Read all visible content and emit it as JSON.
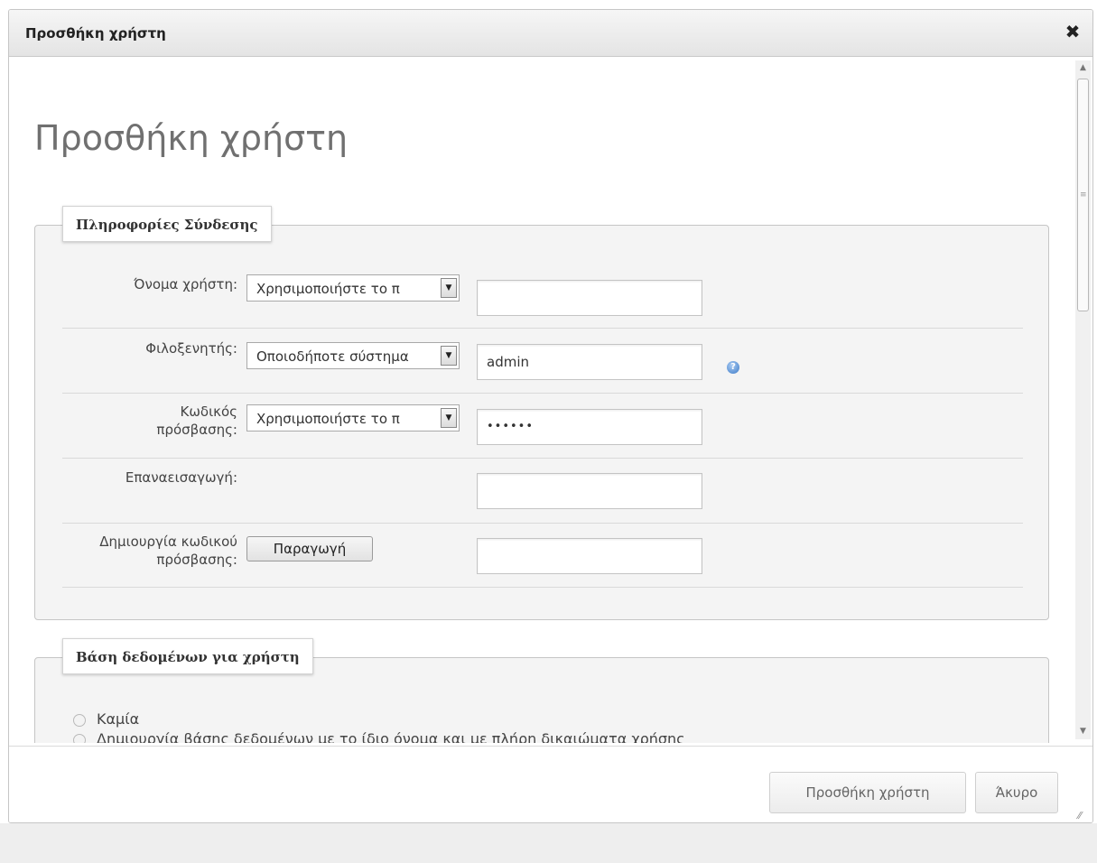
{
  "dialog": {
    "title": "Προσθήκη χρήστη",
    "close_icon": "close-icon"
  },
  "page": {
    "heading": "Προσθήκη χρήστη"
  },
  "login_section": {
    "legend": "Πληροφορίες Σύνδεσης",
    "username": {
      "label": "Όνομα χρήστη:",
      "select_value": "Χρησιμοποιήστε το π",
      "input_value": ""
    },
    "host": {
      "label": "Φιλοξενητής:",
      "select_value": "Οποιοδήποτε σύστημα",
      "input_value": "admin",
      "help_icon": "help-icon"
    },
    "password": {
      "label_line1": "Κωδικός",
      "label_line2": "πρόσβασης:",
      "select_value": "Χρησιμοποιήστε το π",
      "input_value": "••••••"
    },
    "retype": {
      "label": "Επαναεισαγωγή:",
      "input_value": ""
    },
    "generate": {
      "label_line1": "Δημιουργία κωδικού",
      "label_line2": "πρόσβασης:",
      "button_label": "Παραγωγή",
      "input_value": ""
    }
  },
  "database_section": {
    "legend": "Βάση δεδομένων για χρήστη",
    "options": [
      "Καμία",
      "Δημιουργία βάσης δεδομένων με το ίδιο όνομα και με πλήρη δικαιώματα χρήσης"
    ]
  },
  "footer": {
    "add_button": "Προσθήκη χρήστη",
    "cancel_button": "Άκυρο"
  },
  "colors": {
    "titlebar": "#e8e8e8",
    "fieldset_bg": "#f4f4f4",
    "heading": "#707070"
  }
}
